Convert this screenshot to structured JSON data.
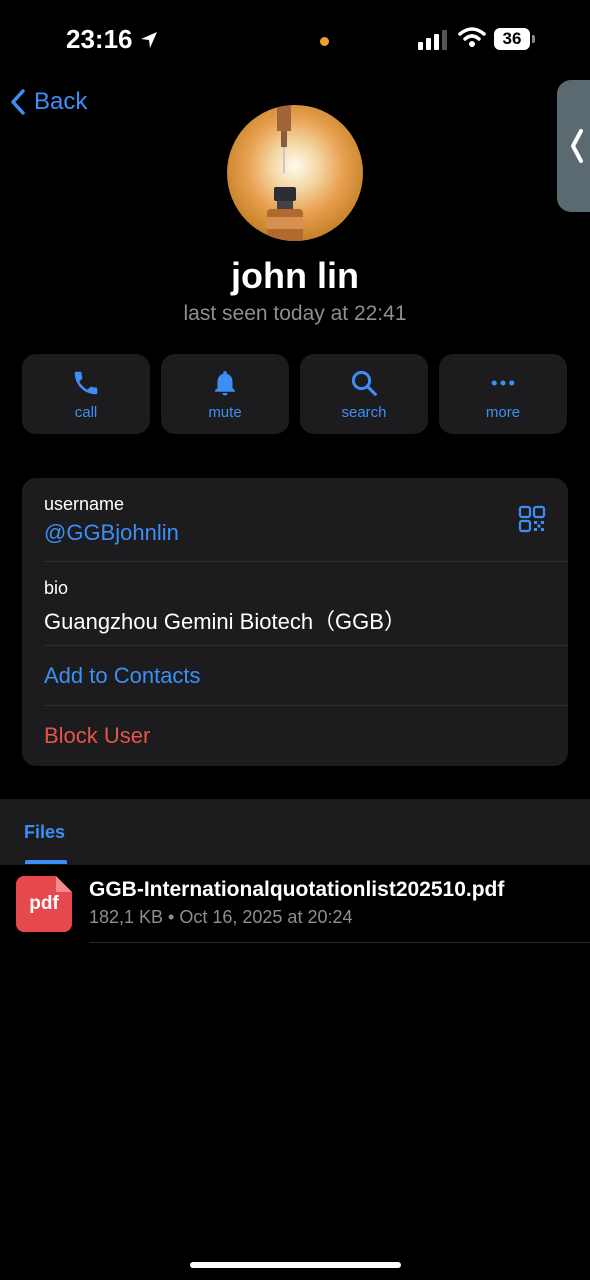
{
  "status_bar": {
    "time": "23:16",
    "battery": "36"
  },
  "nav": {
    "back_label": "Back"
  },
  "profile": {
    "name": "john lin",
    "last_seen": "last seen today at 22:41"
  },
  "actions": [
    {
      "label": "call",
      "icon": "phone-icon"
    },
    {
      "label": "mute",
      "icon": "bell-icon"
    },
    {
      "label": "search",
      "icon": "search-icon"
    },
    {
      "label": "more",
      "icon": "more-icon"
    }
  ],
  "info": {
    "username_label": "username",
    "username_value": "@GGBjohnlin",
    "bio_label": "bio",
    "bio_value": "Guangzhou Gemini Biotech（GGB）",
    "add_contact": "Add to Contacts",
    "block_user": "Block User"
  },
  "files": {
    "tab_label": "Files",
    "items": [
      {
        "icon_label": "pdf",
        "name": "GGB-Internationalquotationlist202510.pdf",
        "meta": "182,1 KB • Oct 16, 2025 at 20:24"
      }
    ]
  },
  "colors": {
    "accent": "#3d8ef5",
    "danger": "#e5534b",
    "card": "#1c1c1e",
    "background": "#000000"
  }
}
